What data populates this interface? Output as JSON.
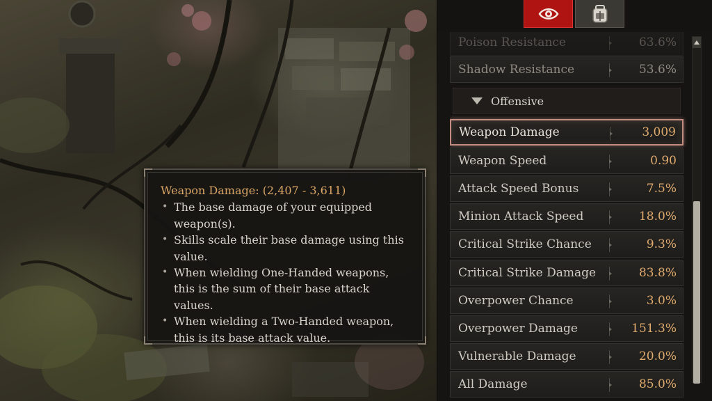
{
  "tooltip": {
    "title": "Weapon Damage:",
    "range": "(2,407 - 3,611)",
    "bullets": [
      "The base damage of your equipped weapon(s).",
      "Skills scale their base damage using this value.",
      "When wielding One-Handed weapons, this is the sum of their base attack values.",
      "When wielding a Two-Handed weapon, this is its base attack value."
    ]
  },
  "panel": {
    "tabs": [
      {
        "icon": "eye-icon"
      },
      {
        "icon": "backpack-icon"
      }
    ],
    "partial_row": {
      "name": "Poison Resistance",
      "value": "63.6%"
    },
    "rows_top": [
      {
        "name": "Shadow Resistance",
        "value": "53.6%"
      }
    ],
    "section": {
      "label": "Offensive"
    },
    "rows": [
      {
        "name": "Weapon Damage",
        "value": "3,009"
      },
      {
        "name": "Weapon Speed",
        "value": "0.90"
      },
      {
        "name": "Attack Speed Bonus",
        "value": "7.5%"
      },
      {
        "name": "Minion Attack Speed",
        "value": "18.0%"
      },
      {
        "name": "Critical Strike Chance",
        "value": "9.3%"
      },
      {
        "name": "Critical Strike Damage",
        "value": "83.8%"
      },
      {
        "name": "Overpower Chance",
        "value": "3.0%"
      },
      {
        "name": "Overpower Damage",
        "value": "151.3%"
      },
      {
        "name": "Vulnerable Damage",
        "value": "20.0%"
      },
      {
        "name": "All Damage",
        "value": "85.0%"
      }
    ]
  },
  "colors": {
    "accent_red": "#b01412",
    "value_gold": "#e1ab6d",
    "selection_border": "#c28d80"
  }
}
